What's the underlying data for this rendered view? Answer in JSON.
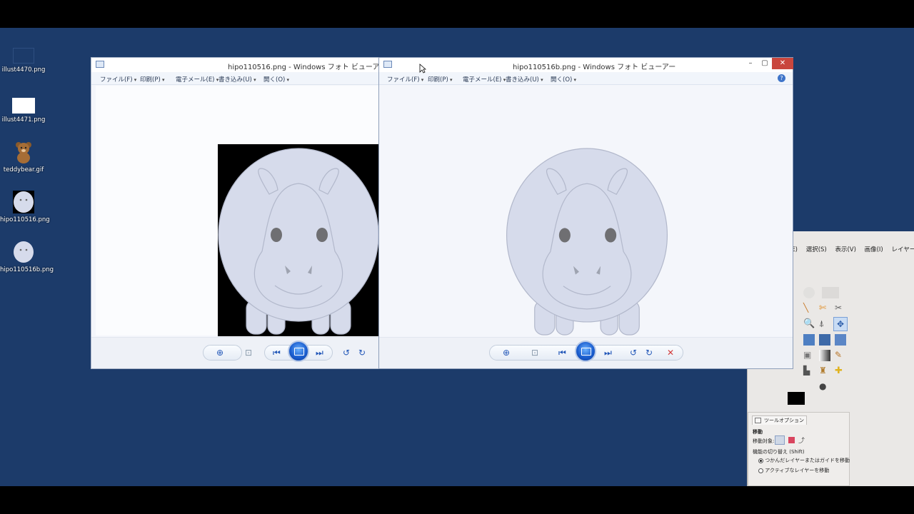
{
  "desktop": {
    "icons": [
      {
        "label": "illust4470.png"
      },
      {
        "label": "illust4471.png"
      },
      {
        "label": "teddybear.gif"
      },
      {
        "label": "hipo110516.png"
      },
      {
        "label": "hipo110516b.png"
      }
    ]
  },
  "viewer1": {
    "title": "hipo110516.png - Windows フォト ビューアー",
    "menu": [
      "ファイル(F)",
      "印刷(P)",
      "電子メール(E)",
      "書き込み(U)",
      "開く(O)"
    ],
    "image_background": "black"
  },
  "viewer2": {
    "title": "hipo110516b.png - Windows フォト ビューアー",
    "menu": [
      "ファイル(F)",
      "印刷(P)",
      "電子メール(E)",
      "書き込み(U)",
      "開く(O)"
    ],
    "help_icon": "help-icon",
    "image_background": "transparent"
  },
  "gimp": {
    "menu": [
      "(E)",
      "選択(S)",
      "表示(V)",
      "画像(I)",
      "レイヤー("
    ],
    "options_tab": "ツールオプション",
    "tool_name": "移動",
    "move_target_label": "移動対象:",
    "toggle_label": "機能の切り替え (Shift)",
    "radio1": "つかんだレイヤーまたはガイドを移動",
    "radio2": "アクティブなレイヤーを移動"
  },
  "colors": {
    "desktop": "#1c3b6a",
    "hippo_fill": "#d6dbeb",
    "hippo_stroke": "#b2b8cb",
    "accent": "#1c5fd0",
    "close": "#e04343"
  }
}
